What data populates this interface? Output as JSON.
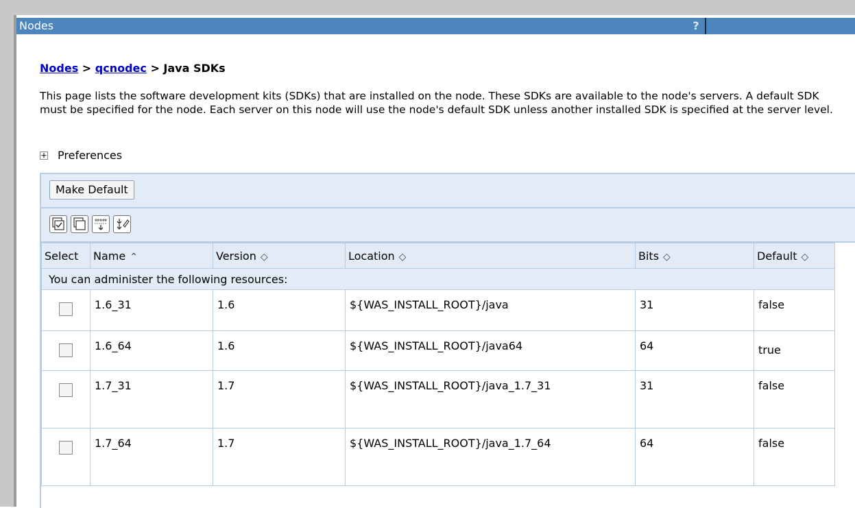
{
  "window": {
    "title": "Nodes",
    "help_label": "?"
  },
  "breadcrumb": {
    "root": "Nodes",
    "sep1": " > ",
    "node": "qcnodec",
    "sep2": " > ",
    "current": "Java SDKs"
  },
  "description": "This page lists the software development kits (SDKs) that are installed on the node. These SDKs are available to the node's servers. A default SDK must be specified for the node. Each server on this node will use the node's default SDK unless another installed SDK is specified at the server level.",
  "preferences": {
    "expand_icon": "+",
    "label": "Preferences"
  },
  "toolbar": {
    "make_default_label": "Make Default",
    "icons": [
      "select-all-icon",
      "deselect-all-icon",
      "show-filter-icon",
      "clear-filter-icon"
    ]
  },
  "table": {
    "columns": [
      {
        "label": "Select",
        "sort": ""
      },
      {
        "label": "Name",
        "sort": "⌃"
      },
      {
        "label": "Version",
        "sort": "◇"
      },
      {
        "label": "Location",
        "sort": "◇"
      },
      {
        "label": "Bits",
        "sort": "◇"
      },
      {
        "label": "Default",
        "sort": "◇"
      }
    ],
    "message": "You can administer the following resources:",
    "rows": [
      {
        "name": "1.6_31",
        "version": "1.6",
        "location": "${WAS_INSTALL_ROOT}/java",
        "bits": "31",
        "default": "false"
      },
      {
        "name": "1.6_64",
        "version": "1.6",
        "location": "${WAS_INSTALL_ROOT}/java64",
        "bits": "64",
        "default": "true"
      },
      {
        "name": "1.7_31",
        "version": "1.7",
        "location": "${WAS_INSTALL_ROOT}/java_1.7_31",
        "bits": "31",
        "default": "false"
      },
      {
        "name": "1.7_64",
        "version": "1.7",
        "location": "${WAS_INSTALL_ROOT}/java_1.7_64",
        "bits": "64",
        "default": "false"
      }
    ]
  },
  "colors": {
    "titlebar": "#4d85bd",
    "panel": "#e3ecf6",
    "border": "#b7cde4",
    "link": "#0000cc"
  }
}
